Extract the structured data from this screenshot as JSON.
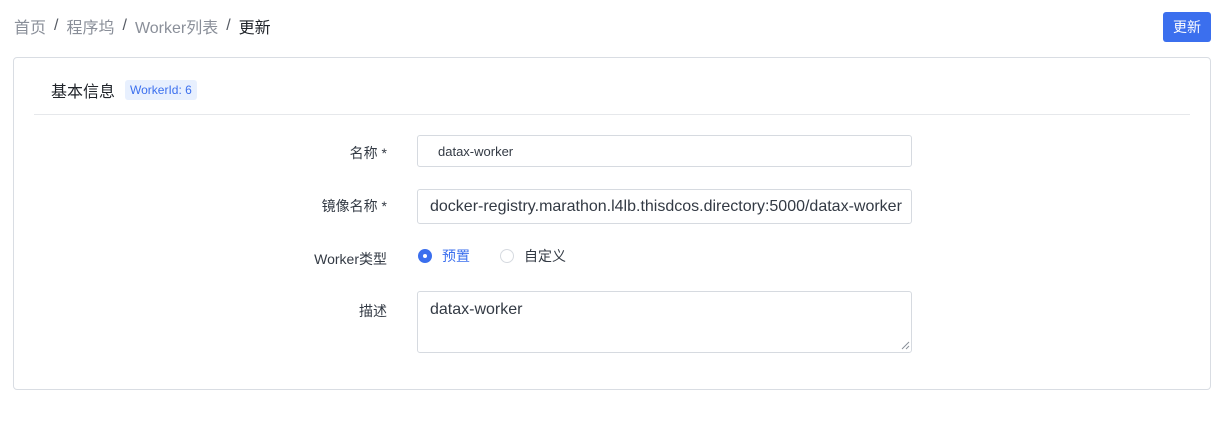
{
  "breadcrumb": {
    "items": [
      "首页",
      "程序坞",
      "Worker列表",
      "更新"
    ],
    "separator": "/"
  },
  "actions": {
    "update_label": "更新"
  },
  "card": {
    "title": "基本信息",
    "tag": "WorkerId: 6"
  },
  "form": {
    "name": {
      "label": "名称 *",
      "value": "datax-worker"
    },
    "image": {
      "label": "镜像名称 *",
      "value": "docker-registry.marathon.l4lb.thisdcos.directory:5000/datax-worker"
    },
    "worker_type": {
      "label": "Worker类型",
      "options": [
        {
          "label": "预置",
          "checked": true
        },
        {
          "label": "自定义",
          "checked": false
        }
      ]
    },
    "description": {
      "label": "描述",
      "value": "datax-worker"
    }
  },
  "colors": {
    "primary": "#3b6fee",
    "border": "#d6dae0",
    "tag_bg": "#e8f0fe"
  },
  "icons": [
    "radio-checked-icon",
    "radio-unchecked-icon",
    "resize-handle-icon"
  ]
}
